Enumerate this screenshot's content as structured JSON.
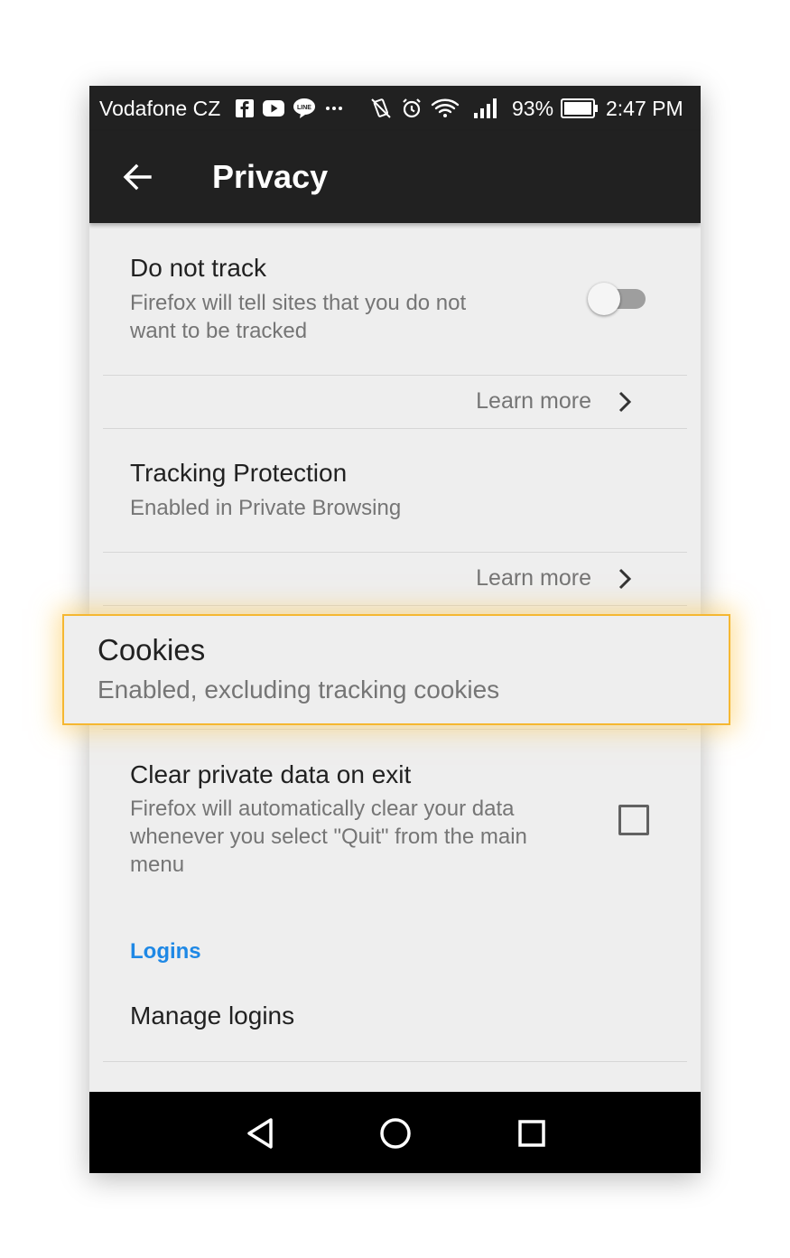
{
  "status_bar": {
    "carrier": "Vodafone CZ",
    "battery_percent": "93%",
    "time": "2:47 PM",
    "icons": [
      "facebook-icon",
      "youtube-icon",
      "line-icon",
      "more-notifications-icon",
      "vibrate-icon",
      "alarm-icon",
      "wifi-icon",
      "signal-icon",
      "battery-icon"
    ]
  },
  "app_bar": {
    "title": "Privacy",
    "back_icon": "arrow-left-icon"
  },
  "items": {
    "do_not_track": {
      "title": "Do not track",
      "subtitle_line1": "Firefox will tell sites that you do not",
      "subtitle_line2": "want to be tracked",
      "toggle_on": false
    },
    "learn_more_1": "Learn more",
    "tracking_protection": {
      "title": "Tracking Protection",
      "subtitle": "Enabled in Private Browsing"
    },
    "learn_more_2": "Learn more",
    "cookies": {
      "title": "Cookies",
      "subtitle": "Enabled, excluding tracking cookies"
    },
    "clear_private_data": {
      "title": "Clear private data on exit",
      "subtitle_line1": "Firefox will automatically clear your data",
      "subtitle_line2": "whenever you select \"Quit\" from the main",
      "subtitle_line3": "menu",
      "checked": false
    },
    "logins_section": "Logins",
    "manage_logins": "Manage logins"
  },
  "colors": {
    "bar": "#212121",
    "section_accent": "#1e88e5",
    "highlight_border": "#f5b731",
    "text_primary": "#212121",
    "text_secondary": "#757575"
  }
}
